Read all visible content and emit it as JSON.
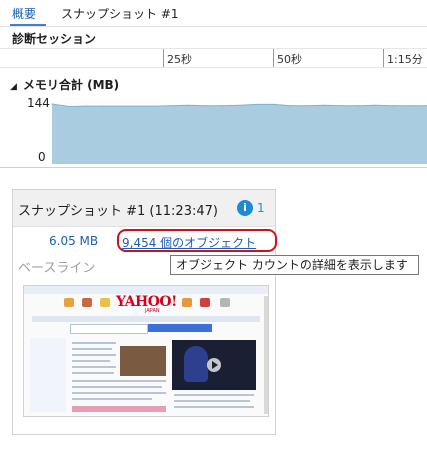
{
  "tabs": {
    "overview": "概要",
    "snapshot": "スナップショット #1"
  },
  "diagnostic_session": {
    "title": "診断セッション",
    "ticks": [
      "25秒",
      "50秒",
      "1:15分"
    ]
  },
  "memory": {
    "title": "メモリ合計 (MB)",
    "y_max": "144",
    "y_min": "0"
  },
  "chart_data": {
    "type": "area",
    "ylabel": "",
    "ylim": [
      0,
      144
    ],
    "series": [
      {
        "values": [
          144,
          138,
          139,
          139,
          139,
          139,
          139,
          140,
          141,
          140,
          140,
          141,
          143,
          143,
          140,
          140,
          141,
          140,
          140,
          141,
          140,
          140,
          140
        ]
      }
    ],
    "fill_color": "#a9cce0",
    "line_color": "#7fb1d1"
  },
  "snapshot_card": {
    "title": "スナップショット #1 (11:23:47)",
    "info_count": "1",
    "size": "6.05 MB",
    "objects_link": "9,454 個のオブジェクト",
    "baseline": "ベースライン"
  },
  "tooltip": "オブジェクト カウントの詳細を表示します",
  "thumbnail": {
    "logo": "YAHOO!",
    "logo_sub": "JAPAN"
  },
  "colors": {
    "accent": "#1a5fb4",
    "highlight": "#d0101a",
    "info": "#1e8ad6"
  }
}
